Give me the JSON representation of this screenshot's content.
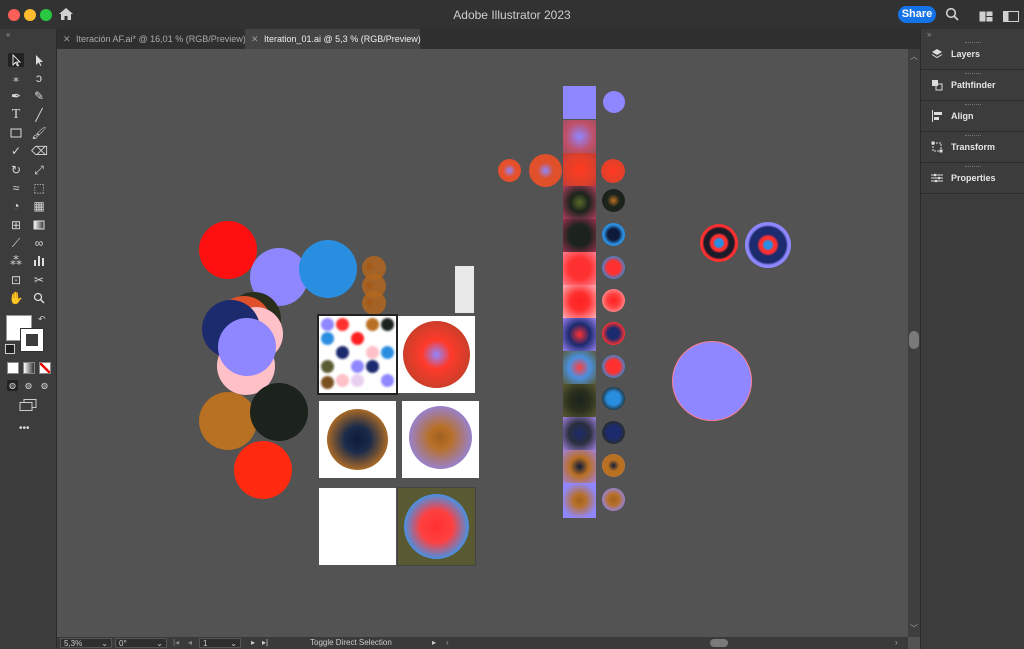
{
  "window": {
    "title": "Adobe Illustrator 2023",
    "share_label": "Share"
  },
  "tabs": [
    {
      "label": "Iteración AF.ai* @ 16,01 % (RGB/Preview)",
      "active": false
    },
    {
      "label": "Iteration_01.ai @ 5,3 % (RGB/Preview)",
      "active": true
    }
  ],
  "right_panel": {
    "items": [
      {
        "label": "Layers",
        "icon": "layers-icon"
      },
      {
        "label": "Pathfinder",
        "icon": "pathfinder-icon"
      },
      {
        "label": "Align",
        "icon": "align-icon"
      },
      {
        "label": "Transform",
        "icon": "transform-icon"
      },
      {
        "label": "Properties",
        "icon": "properties-icon"
      }
    ]
  },
  "status_bar": {
    "zoom": "5,3%",
    "rotation": "0°",
    "artboard": "1",
    "tool_hint": "Toggle Direct Selection"
  },
  "toolbar": {
    "more_label": "•••"
  },
  "colors": {
    "accent": "#1473e6",
    "lavender": "#8f87ff",
    "red": "#ff1a1a",
    "blue": "#2a8ee0",
    "navy": "#1c2a6e",
    "pink": "#ffc0c8",
    "brown": "#b87023",
    "dark_green": "#1b231c",
    "orange_red": "#ff2a10",
    "olive": "#5a5a32"
  }
}
